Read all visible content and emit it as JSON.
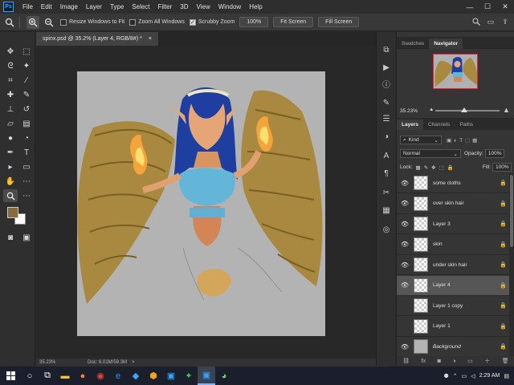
{
  "app": {
    "logo": "Ps"
  },
  "menu": [
    "File",
    "Edit",
    "Image",
    "Layer",
    "Type",
    "Select",
    "Filter",
    "3D",
    "View",
    "Window",
    "Help"
  ],
  "window_controls": {
    "minimize": "—",
    "maximize": "☐",
    "close": "✕"
  },
  "options": {
    "resize_windows": "Resize Windows to Fit",
    "zoom_all": "Zoom All Windows",
    "scrubby_zoom": "Scrubby Zoom",
    "zoom_value": "100%",
    "fit_screen": "Fit Screen",
    "fill_screen": "Fill Screen"
  },
  "document": {
    "tab_title": "spinx.psd @ 35.2% (Layer 4, RGB/8#) *",
    "tab_close": "×"
  },
  "status": {
    "zoom": "35.23%",
    "doc": "Doc: 6.01M/59.3M",
    "arrow": ">"
  },
  "panels": {
    "top_tabs": [
      "Swatches",
      "Navigator"
    ],
    "navigator_zoom": "35.23%",
    "navigator_slider_pos": 0.45,
    "layer_tabs": [
      "Layers",
      "Channels",
      "Paths"
    ],
    "kind": "Kind",
    "blend_mode": "Normal",
    "opacity_label": "Opacity:",
    "opacity_value": "100%",
    "lock_label": "Lock:",
    "fill_label": "Fill:",
    "fill_value": "100%"
  },
  "layers": [
    {
      "name": "some cloths",
      "visible": true,
      "selected": false,
      "locked": true
    },
    {
      "name": "over skin hair",
      "visible": true,
      "selected": false,
      "locked": true
    },
    {
      "name": "Layer 3",
      "visible": true,
      "selected": false,
      "locked": true
    },
    {
      "name": "skin",
      "visible": true,
      "selected": false,
      "locked": true
    },
    {
      "name": "under skin hair",
      "visible": true,
      "selected": false,
      "locked": true
    },
    {
      "name": "Layer 4",
      "visible": true,
      "selected": true,
      "locked": true
    },
    {
      "name": "Layer 1 copy",
      "visible": false,
      "selected": false,
      "locked": true
    },
    {
      "name": "Layer 1",
      "visible": false,
      "selected": false,
      "locked": true
    },
    {
      "name": "Background",
      "visible": true,
      "selected": false,
      "locked": true
    }
  ],
  "taskbar": {
    "time": "2:29 AM"
  },
  "colors": {
    "accent": "#31a8ff",
    "foreground": "#8a6a3b",
    "background": "#ffffff"
  }
}
